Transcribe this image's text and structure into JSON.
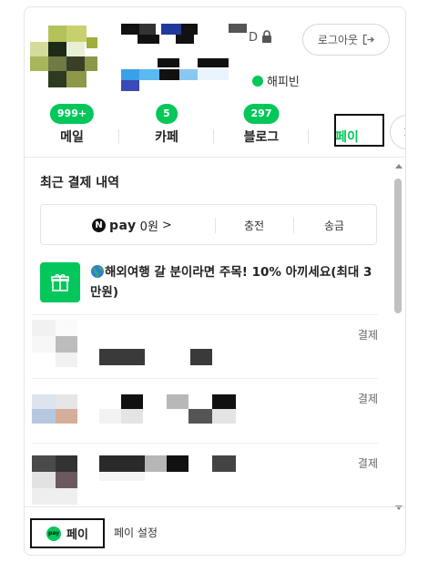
{
  "profile": {
    "name_suffix": "D",
    "happybean_label": "해피빈",
    "logout_label": "로그아웃"
  },
  "services": [
    {
      "label": "메일",
      "badge": "999+"
    },
    {
      "label": "카페",
      "badge": "5"
    },
    {
      "label": "블로그",
      "badge": "297"
    },
    {
      "label": "페이",
      "badge": ""
    }
  ],
  "payment": {
    "section_title": "최근 결제 내역",
    "npay_n": "N",
    "npay_word": "pay",
    "npay_balance": "0원",
    "npay_chevron": ">",
    "charge_label": "충전",
    "transfer_label": "송금",
    "promo_text": "해외여행 갈 분이라면 주목! 10% 아끼세요(최대 3만원)",
    "history": [
      {
        "status": "결제"
      },
      {
        "status": "결제"
      },
      {
        "status": "결제"
      }
    ]
  },
  "footer": {
    "pay_logo_text": "pay",
    "pay_label": "페이",
    "settings_label": "페이 설정"
  },
  "colors": {
    "brand_green": "#03c75a",
    "badge_text": "#ffffff"
  }
}
